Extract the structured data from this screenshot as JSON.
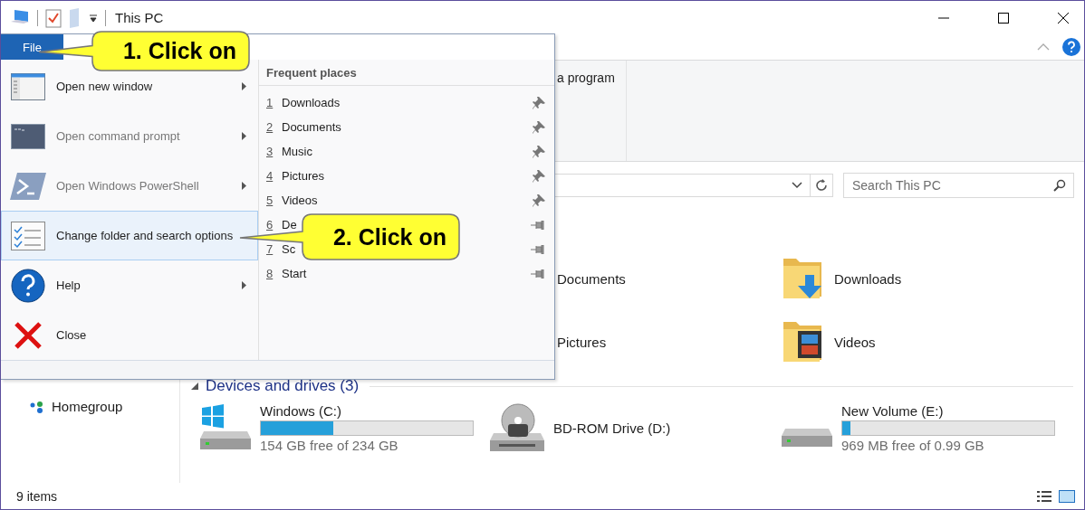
{
  "window": {
    "title": "This PC",
    "file_tab": "File"
  },
  "file_menu": {
    "items": [
      {
        "kind": "new-window",
        "label": "Open new window",
        "submenu": true,
        "disabled": false,
        "selected": false
      },
      {
        "kind": "command-prompt",
        "label": "Open command prompt",
        "submenu": true,
        "disabled": true,
        "selected": false
      },
      {
        "kind": "powershell",
        "label": "Open Windows PowerShell",
        "submenu": true,
        "disabled": true,
        "selected": false
      },
      {
        "kind": "options",
        "label": "Change folder and search options",
        "submenu": false,
        "disabled": false,
        "selected": true
      },
      {
        "kind": "help",
        "label": "Help",
        "submenu": true,
        "disabled": false,
        "selected": false
      },
      {
        "kind": "close",
        "label": "Close",
        "submenu": false,
        "disabled": false,
        "selected": false
      }
    ],
    "frequent_places": {
      "title": "Frequent places",
      "items": [
        {
          "index": "1",
          "label": "Downloads",
          "pinned": true
        },
        {
          "index": "2",
          "label": "Documents",
          "pinned": true
        },
        {
          "index": "3",
          "label": "Music",
          "pinned": true
        },
        {
          "index": "4",
          "label": "Pictures",
          "pinned": true
        },
        {
          "index": "5",
          "label": "Videos",
          "pinned": true
        },
        {
          "index": "6",
          "label": "De",
          "pinned": false
        },
        {
          "index": "7",
          "label": "Sc",
          "pinned": false
        },
        {
          "index": "8",
          "label": "Start",
          "pinned": false
        }
      ]
    }
  },
  "ribbon": {
    "partial_label": "a program"
  },
  "search": {
    "placeholder": "Search This PC"
  },
  "nav_pane": {
    "items": [
      {
        "label": "Homegroup"
      }
    ]
  },
  "folders": [
    {
      "label": "Documents"
    },
    {
      "label": "Downloads",
      "kind": "download"
    },
    {
      "label": "Pictures"
    },
    {
      "label": "Videos",
      "kind": "video"
    }
  ],
  "devices": {
    "title": "Devices and drives (3)",
    "expanded": true,
    "drives": [
      {
        "kind": "hdd-windows",
        "name": "Windows (C:)",
        "level": 0.34,
        "free": "154 GB free of 234 GB"
      },
      {
        "kind": "bd-rom",
        "name": "BD-ROM Drive (D:)"
      },
      {
        "kind": "hdd",
        "name": "New Volume (E:)",
        "level": 0.04,
        "free": "969 MB free of 0.99 GB"
      }
    ]
  },
  "status_bar": {
    "items": "9 items"
  },
  "callouts": [
    {
      "text": "1. Click on"
    },
    {
      "text": "2. Click on"
    }
  ]
}
